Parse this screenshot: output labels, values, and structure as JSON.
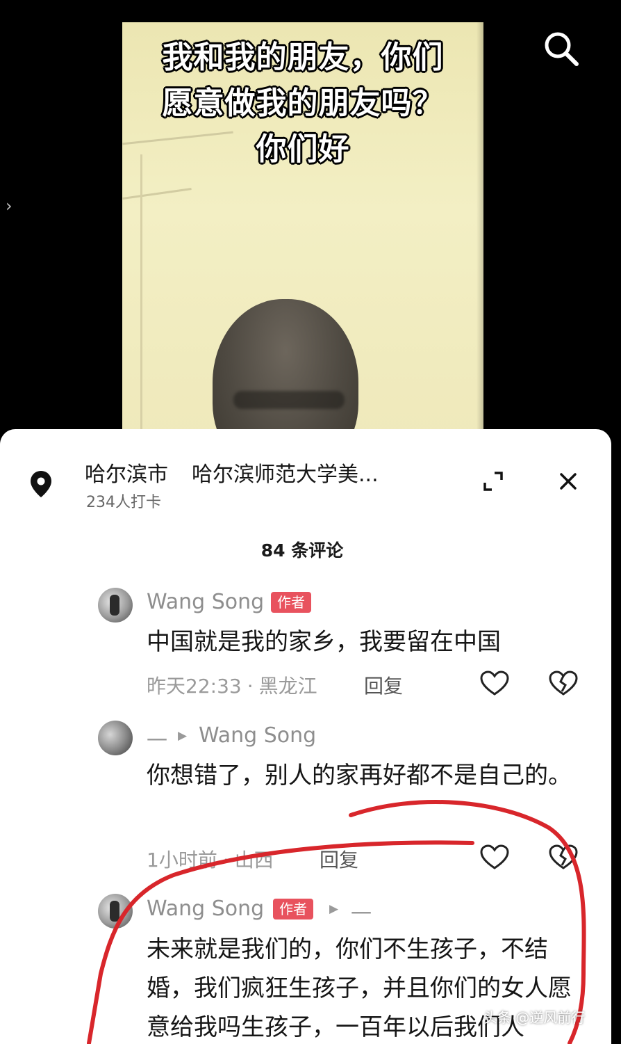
{
  "video": {
    "caption": "我和我的朋友，你们愿意做我的朋友吗？你们好"
  },
  "location": {
    "city": "哈尔滨市",
    "place": "哈尔滨师范大学美...",
    "checkins": "234人打卡"
  },
  "comments_header": {
    "count_label": "84 条评论"
  },
  "comments": [
    {
      "user": "Wang Song",
      "tag": "作者",
      "text": "中国就是我的家乡，我要留在中国",
      "time": "昨天22:33",
      "region": "黑龙江",
      "reply_label": "回复"
    },
    {
      "user": "一",
      "reply_to": "Wang Song",
      "text": "你想错了，别人的家再好都不是自己的。",
      "time": "1小时前",
      "region": "山西",
      "reply_label": "回复"
    },
    {
      "user": "Wang Song",
      "tag": "作者",
      "reply_to": "一",
      "text": "未来就是我们的，你们不生孩子，不结婚，我们疯狂生孩子，并且你们的女人愿意给我吗生孩子，一百年以后我们人"
    }
  ],
  "watermark": "头条 @逆风前行",
  "colors": {
    "author_tag": "#e8525e",
    "annotation_red": "#d8262b",
    "sheet_bg": "#ffffff"
  },
  "icons": [
    "search-icon",
    "location-pin-icon",
    "expand-icon",
    "close-icon",
    "heart-icon",
    "broken-heart-icon",
    "chevron-right-icon"
  ]
}
